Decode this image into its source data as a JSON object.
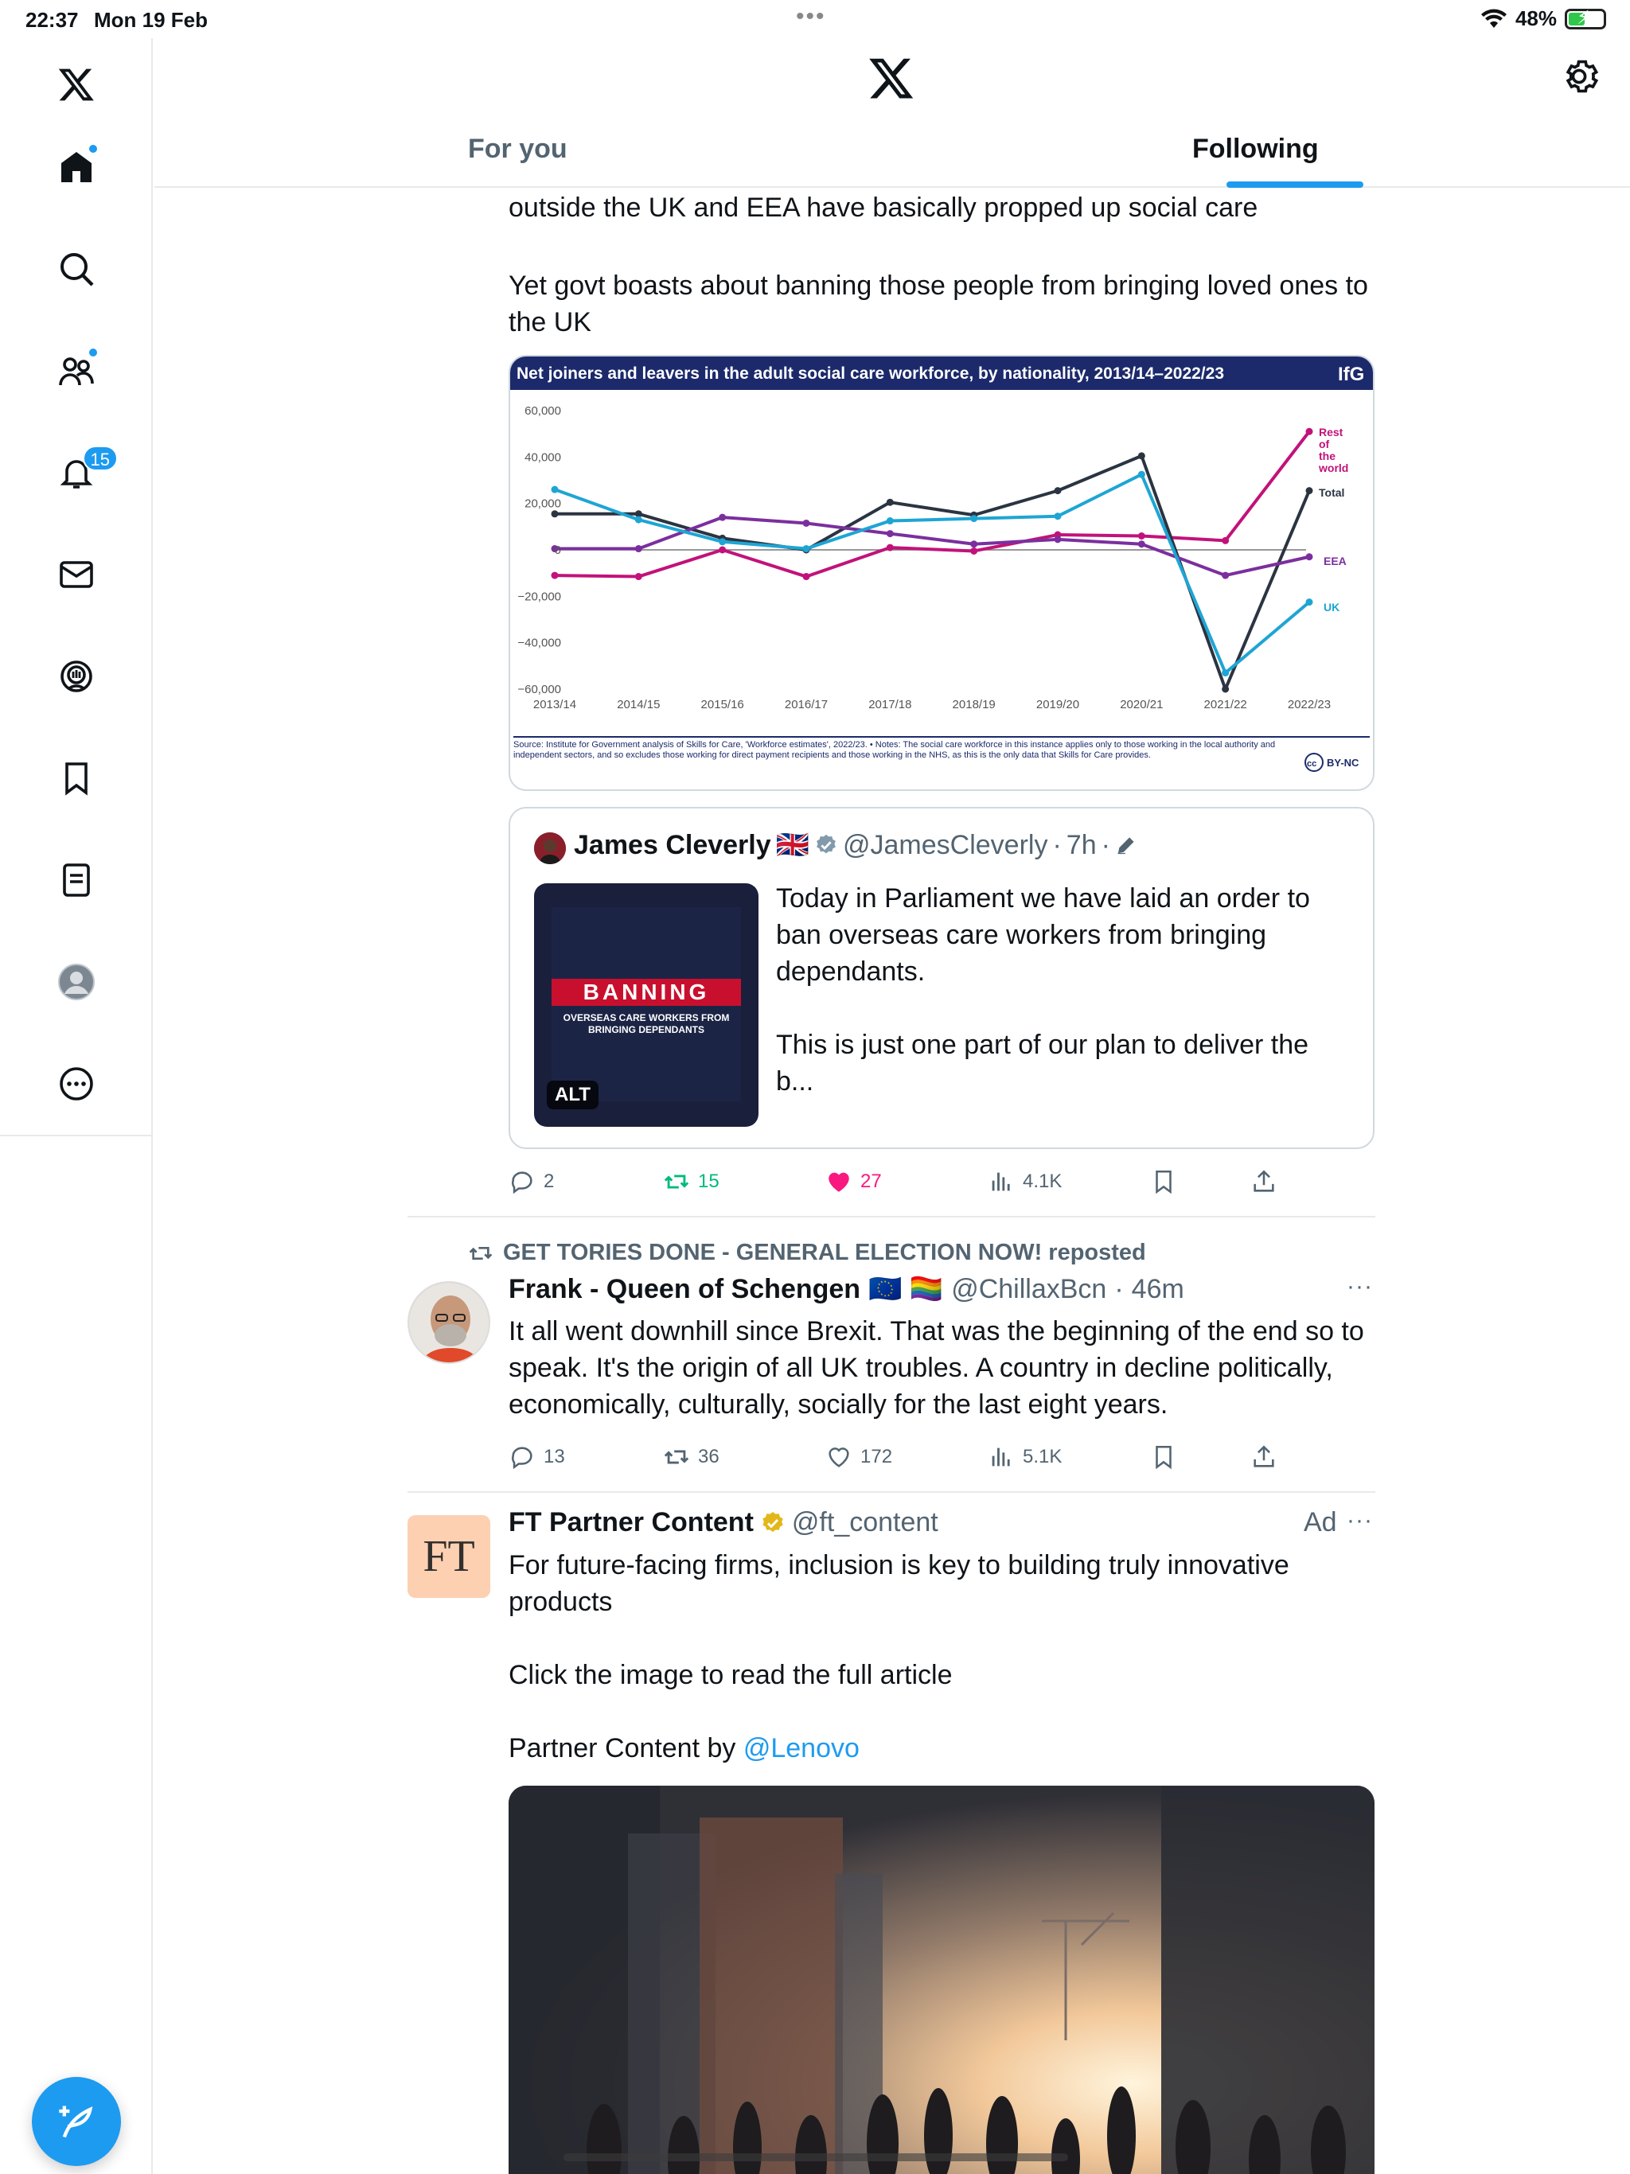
{
  "status_bar": {
    "time": "22:37",
    "date": "Mon 19 Feb",
    "battery": "48%",
    "battery_level": 0.48
  },
  "sidebar": {
    "notification_count": "15",
    "items": [
      "home",
      "search",
      "communities",
      "notifications",
      "messages",
      "spaces",
      "bookmarks",
      "lists",
      "profile",
      "more"
    ]
  },
  "header": {
    "tabs": [
      "For you",
      "Following"
    ],
    "active_tab": "Following"
  },
  "tweet1": {
    "text_a": "outside the UK and EEA have basically propped up social care",
    "text_b": "Yet govt boasts about banning those people from bringing loved ones to the UK",
    "chart": {
      "title": "Net joiners and leavers in the adult social care workforce, by nationality, 2013/14–2022/23",
      "brand": "IfG",
      "source": "Source: Institute for Government analysis of Skills for Care, 'Workforce estimates', 2022/23. • Notes: The social care workforce in this instance applies only to those working in the local authority and independent sectors, and so excludes those working for direct payment recipients and those working in the NHS, as this is the only data that Skills for Care provides.",
      "license": "BY-NC"
    },
    "quote": {
      "name": "James Cleverly",
      "flag": "🇬🇧",
      "handle": "@JamesCleverly",
      "time": "7h",
      "text": "Today in Parliament we have laid an order to ban overseas care workers from bringing dependants.\n\nThis is just one part of our plan to deliver the b...",
      "image_title": "BANNING",
      "image_subtitle": "OVERSEAS CARE WORKERS FROM BRINGING DEPENDANTS",
      "alt": "ALT"
    },
    "actions": {
      "replies": "2",
      "retweets": "15",
      "likes": "27",
      "views": "4.1K"
    }
  },
  "tweet2": {
    "reposted_by": "GET TORIES DONE - GENERAL ELECTION NOW! reposted",
    "name": "Frank - Queen of Schengen",
    "emojis": "🇪🇺 🏳️‍🌈",
    "handle": "@ChillaxBcn",
    "time": "46m",
    "text": "It all went downhill since Brexit. That was the beginning of the end so to speak. It's the origin of all UK troubles. A country in decline politically, economically, culturally, socially for the last eight years.",
    "actions": {
      "replies": "13",
      "retweets": "36",
      "likes": "172",
      "views": "5.1K"
    }
  },
  "tweet3": {
    "avatar_text": "FT",
    "name": "FT Partner Content",
    "handle": "@ft_content",
    "ad": "Ad",
    "text_main": "For future-facing firms, inclusion is key to building truly innovative products\n\nClick the image to read the full article\n\nPartner Content by ",
    "link": "@Lenovo"
  },
  "colors": {
    "accent": "#1d9bf0",
    "like": "#f91880",
    "retweet": "#00ba7c",
    "uk": "#1ea5d4",
    "eea": "#7b2f9e",
    "row": "#c2127a",
    "total": "#2b3441"
  },
  "chart_data": {
    "type": "line",
    "title": "Net joiners and leavers in the adult social care workforce, by nationality, 2013/14–2022/23",
    "categories": [
      "2013/14",
      "2014/15",
      "2015/16",
      "2016/17",
      "2017/18",
      "2018/19",
      "2019/20",
      "2020/21",
      "2021/22",
      "2022/23"
    ],
    "ylim": [
      -60000,
      60000
    ],
    "yticks": [
      "60,000",
      "40,000",
      "20,000",
      "0",
      "−20,000",
      "−40,000",
      "−60,000"
    ],
    "series": [
      {
        "name": "Rest of the world",
        "color": "#c2127a",
        "values": [
          -11000,
          -11500,
          0,
          -11500,
          1000,
          -500,
          6500,
          6000,
          4000,
          51000
        ]
      },
      {
        "name": "Total",
        "color": "#2b3441",
        "values": [
          15500,
          15500,
          5000,
          0,
          20500,
          15000,
          25500,
          40500,
          -60000,
          25500
        ]
      },
      {
        "name": "EEA",
        "color": "#7b2f9e",
        "values": [
          500,
          500,
          14000,
          11500,
          7000,
          2500,
          4500,
          2500,
          -11000,
          -3000
        ]
      },
      {
        "name": "UK",
        "color": "#1ea5d4",
        "values": [
          26000,
          13000,
          3500,
          500,
          12500,
          13500,
          14500,
          32500,
          -53000,
          -22500
        ]
      }
    ]
  }
}
